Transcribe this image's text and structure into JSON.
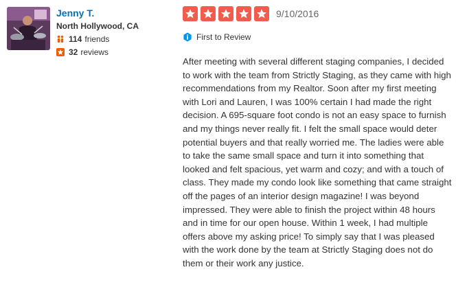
{
  "user": {
    "name": "Jenny T.",
    "location": "North Hollywood, CA",
    "friends_count": "114",
    "friends_label": "friends",
    "reviews_count": "32",
    "reviews_label": "reviews"
  },
  "review": {
    "rating": 5,
    "max_rating": 5,
    "date": "9/10/2016",
    "badge": "First to Review",
    "text": "After meeting with several different staging companies, I decided to work with the team from Strictly Staging, as they came with high recommendations from my Realtor. Soon after my first meeting with Lori and Lauren, I was 100% certain I had made the right decision.  A 695-square foot condo is not an easy space to furnish and my things never really fit.  I felt the small space would deter potential buyers and that really worried me.  The ladies were able to take the same small space and turn it into something that looked and felt spacious, yet warm and cozy; and with a touch of class.  They made my condo look like something that came straight off the pages of an interior design magazine!  I was beyond impressed.  They were able to finish the project within 48 hours and in time for our open house.  Within 1 week, I had multiple offers above my asking price! To simply say that I was pleased with the work done by the team at Strictly Staging does not do them or their work any justice."
  },
  "colors": {
    "star_red": "#f15c4f",
    "name_blue": "#0073bb",
    "friends_orange": "#f15c00",
    "reviews_orange": "#f15c00",
    "badge_teal": "#0097ec"
  },
  "icons": {
    "friends": "friends-icon",
    "reviews": "star-icon",
    "badge": "info-icon",
    "rating": "star-icon"
  }
}
